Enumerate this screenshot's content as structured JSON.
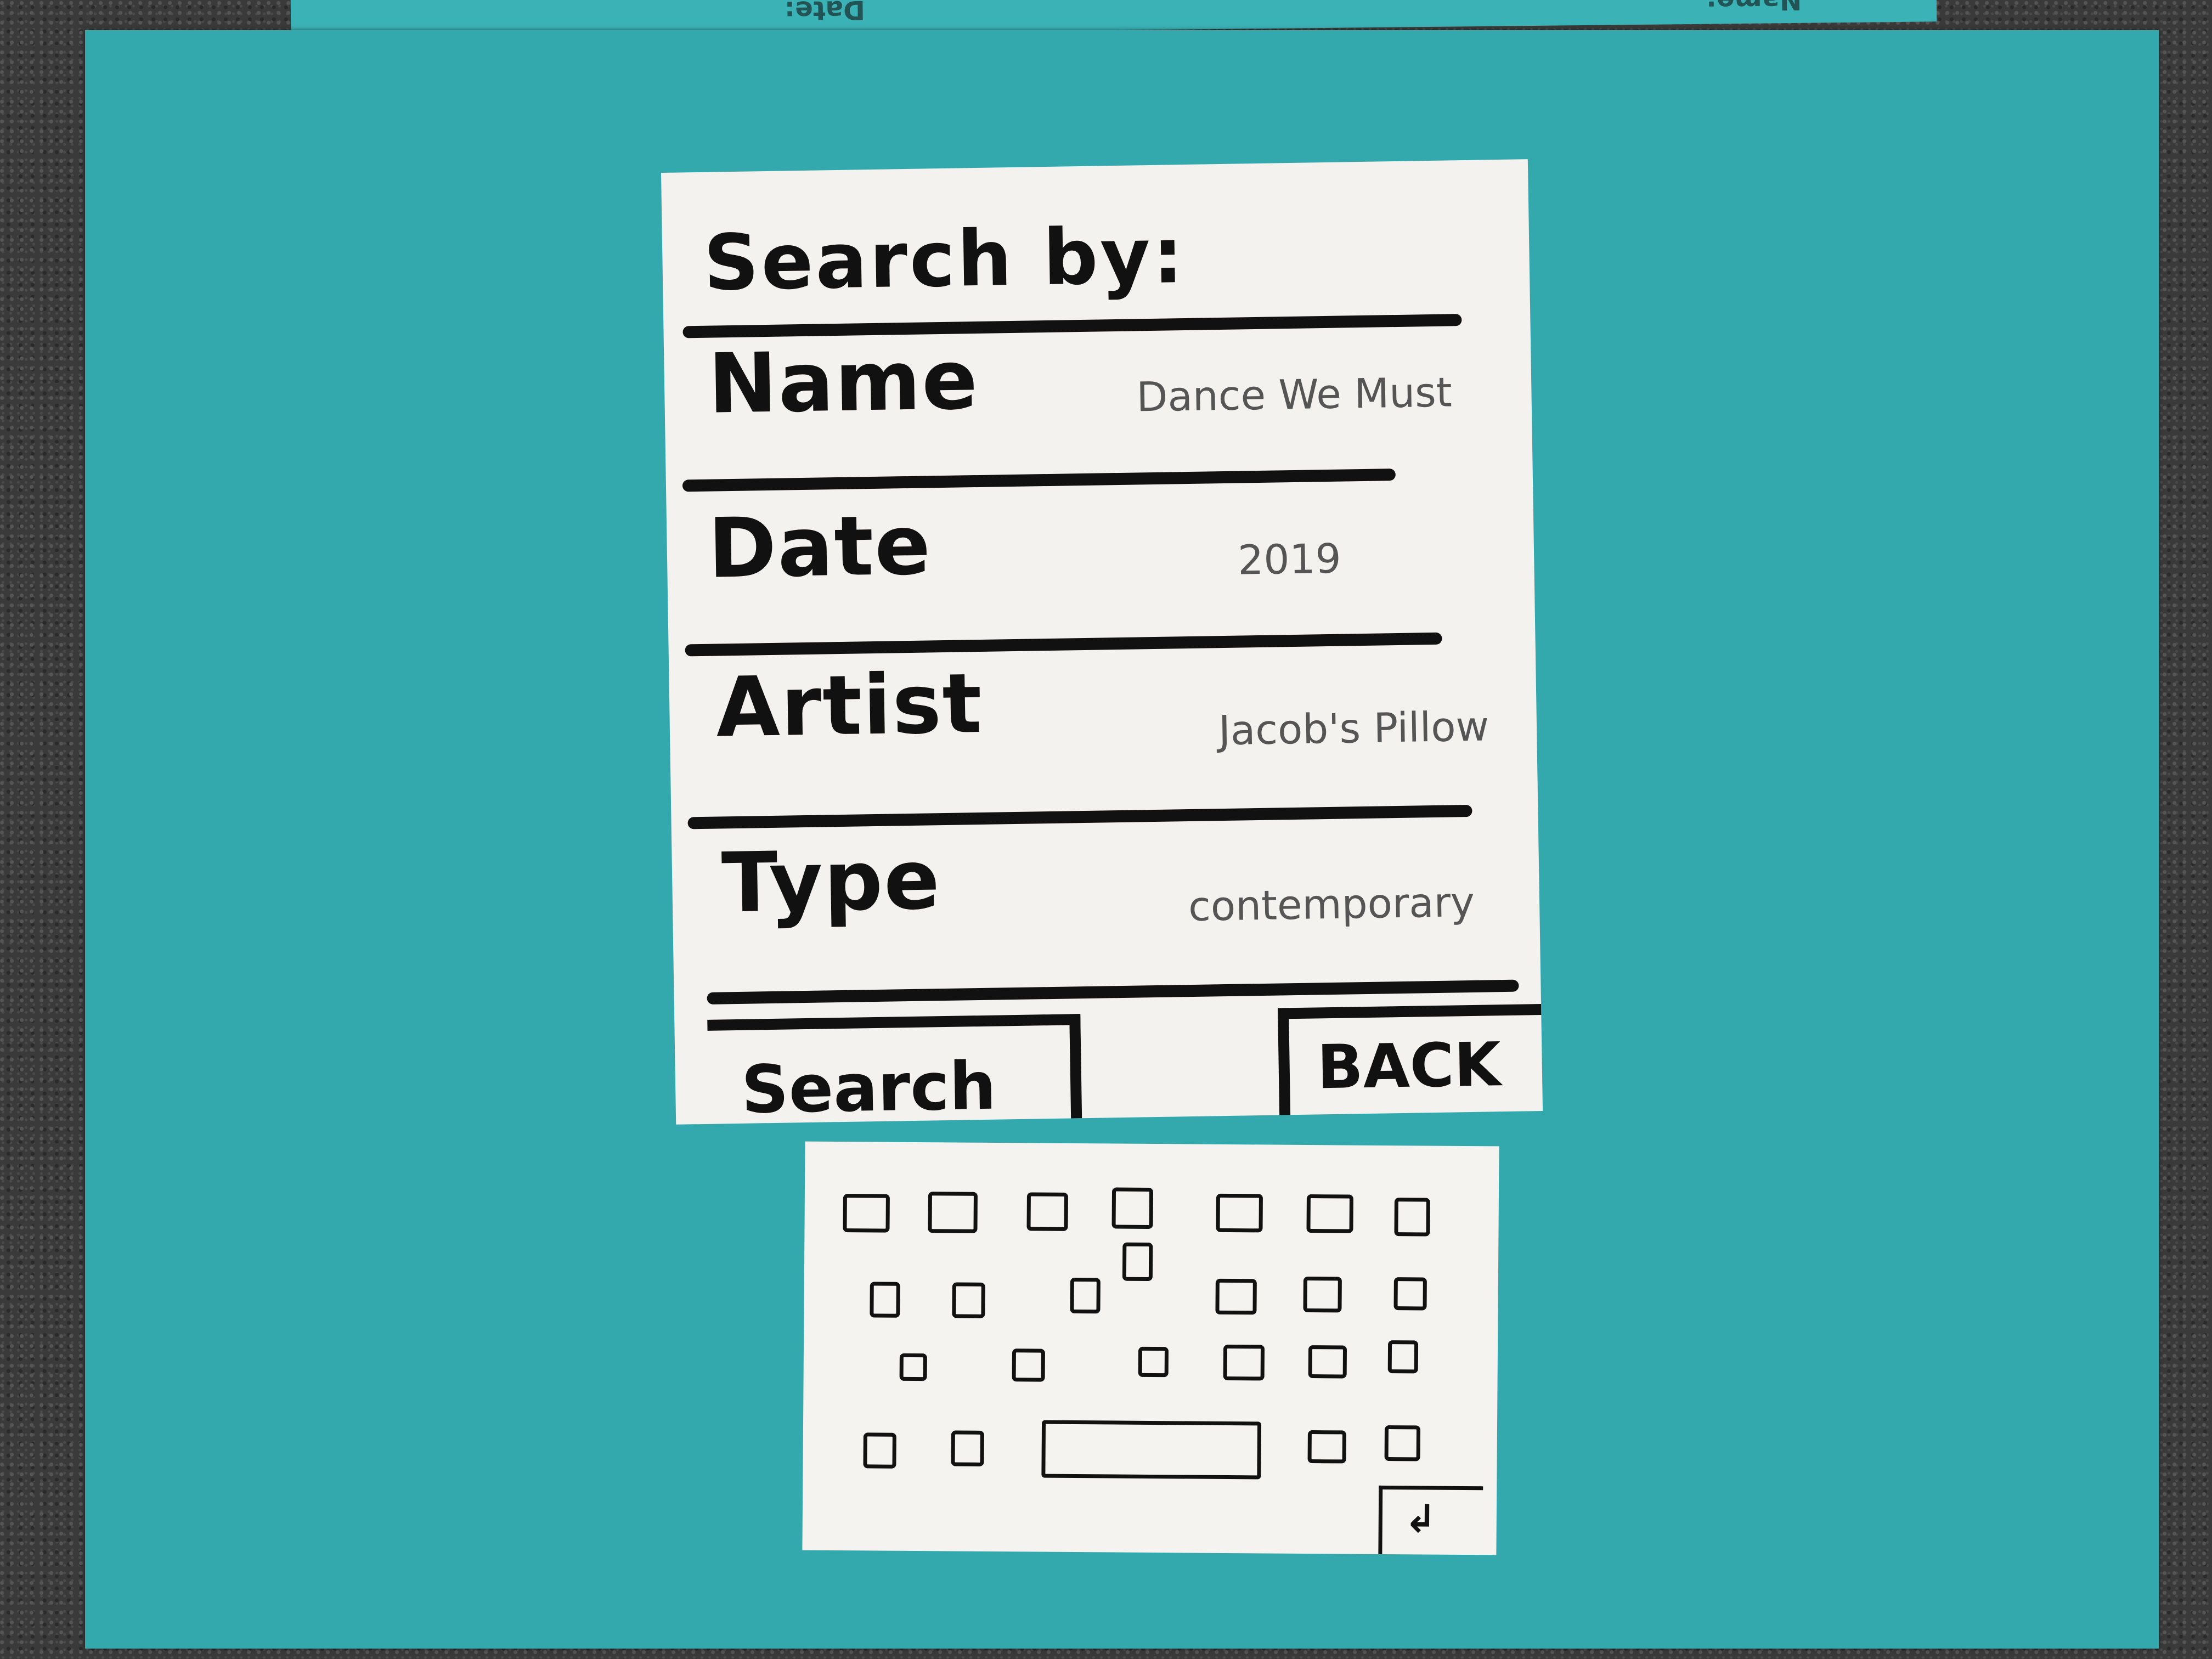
{
  "background_color": "#33a9ad",
  "top_card": {
    "text_left": "Date:",
    "text_right": "Name:"
  },
  "search_screen": {
    "title": "Search by:",
    "fields": [
      {
        "label": "Name",
        "value": "Dance We Must"
      },
      {
        "label": "Date",
        "value": "2019"
      },
      {
        "label": "Artist",
        "value": "Jacob's Pillow"
      },
      {
        "label": "Type",
        "value": "contemporary"
      }
    ],
    "search_button": "Search",
    "back_button": "BACK"
  },
  "keyboard": {
    "go_key_icon": "return-arrow-icon",
    "go_key_glyph": "↲"
  }
}
